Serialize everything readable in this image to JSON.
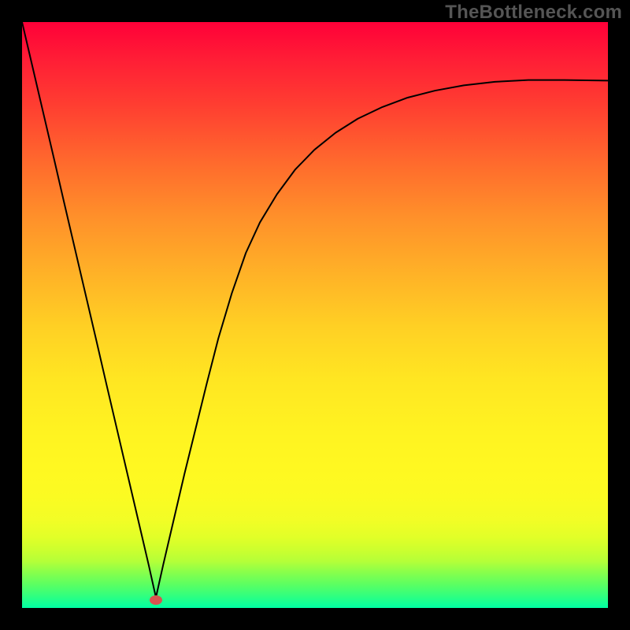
{
  "watermark": "TheBottleneck.com",
  "marker": {
    "cx_frac": 0.2285,
    "cy_frac": 0.9865,
    "color": "#d9534f"
  },
  "chart_data": {
    "type": "line",
    "title": "",
    "xlabel": "",
    "ylabel": "",
    "xlim": [
      0,
      1
    ],
    "ylim": [
      0,
      1
    ],
    "grid": false,
    "legend": false,
    "series": [
      {
        "name": "curve",
        "x": [
          0.0,
          0.018,
          0.036,
          0.054,
          0.072,
          0.09,
          0.108,
          0.126,
          0.144,
          0.162,
          0.18,
          0.198,
          0.216,
          0.2285,
          0.241,
          0.259,
          0.277,
          0.296,
          0.315,
          0.335,
          0.358,
          0.382,
          0.406,
          0.435,
          0.466,
          0.499,
          0.535,
          0.573,
          0.615,
          0.658,
          0.705,
          0.754,
          0.807,
          0.864,
          0.926,
          1.0
        ],
        "y": [
          1.0,
          0.923,
          0.846,
          0.769,
          0.691,
          0.614,
          0.537,
          0.46,
          0.382,
          0.305,
          0.228,
          0.151,
          0.074,
          0.018,
          0.074,
          0.151,
          0.228,
          0.305,
          0.382,
          0.46,
          0.537,
          0.606,
          0.658,
          0.706,
          0.748,
          0.782,
          0.811,
          0.835,
          0.855,
          0.871,
          0.883,
          0.892,
          0.898,
          0.901,
          0.901,
          0.9
        ],
        "stroke": "#000000",
        "stroke_width": 2
      }
    ]
  }
}
